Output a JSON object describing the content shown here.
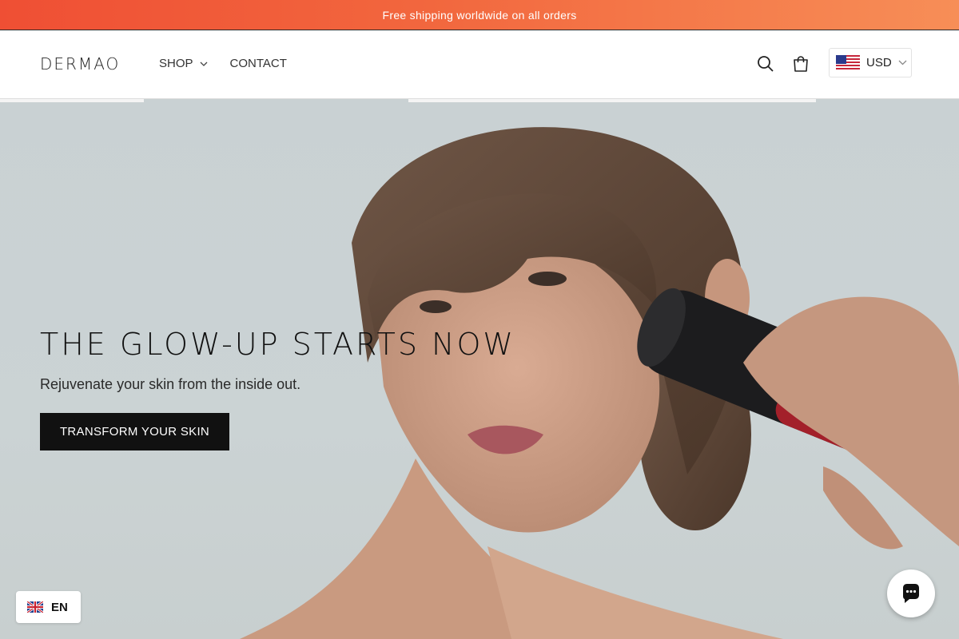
{
  "announcement": {
    "text": "Free shipping worldwide on all orders"
  },
  "header": {
    "logo": "DERMAO",
    "nav": [
      {
        "label": "SHOP",
        "has_dropdown": true
      },
      {
        "label": "CONTACT",
        "has_dropdown": false
      }
    ],
    "icons": [
      "search-icon",
      "cart-icon"
    ],
    "currency": {
      "code": "USD",
      "flag": "us-flag-icon"
    }
  },
  "hero": {
    "title": "THE GLOW-UP STARTS NOW",
    "subtitle": "Rejuvenate your skin from the inside out.",
    "cta_label": "TRANSFORM YOUR SKIN",
    "image": "woman using red and black skincare device on cheek"
  },
  "language": {
    "code": "EN",
    "flag": "uk-flag-icon"
  },
  "chat": {
    "icon": "chat-bubble-icon"
  },
  "colors": {
    "announcement_start": "#ef4f34",
    "announcement_end": "#f78e57",
    "button": "#111111",
    "hero_bg": "#cbd3d4"
  }
}
